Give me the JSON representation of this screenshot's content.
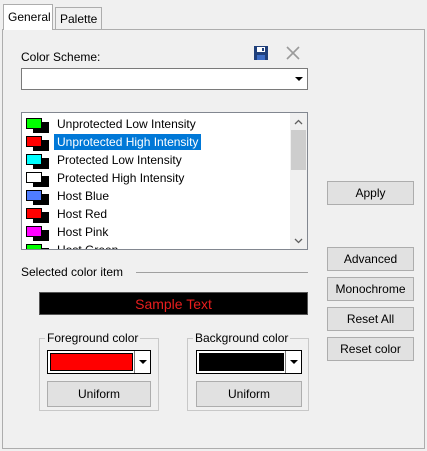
{
  "tabs": [
    {
      "label": "General",
      "active": true
    },
    {
      "label": "Palette",
      "active": false
    }
  ],
  "color_scheme": {
    "label": "Color Scheme:",
    "value": "",
    "save_icon": "save-icon",
    "delete_icon": "close-icon"
  },
  "color_items": [
    {
      "label": "Unprotected Low Intensity",
      "color": "#00ff00",
      "selected": false
    },
    {
      "label": "Unprotected High Intensity",
      "color": "#ff0000",
      "selected": true
    },
    {
      "label": "Protected Low Intensity",
      "color": "#00ffff",
      "selected": false
    },
    {
      "label": "Protected High Intensity",
      "color": "#ffffff",
      "selected": false
    },
    {
      "label": "Host Blue",
      "color": "#4f7cff",
      "selected": false
    },
    {
      "label": "Host Red",
      "color": "#ff0000",
      "selected": false
    },
    {
      "label": "Host Pink",
      "color": "#ff00ff",
      "selected": false
    },
    {
      "label": "Host Green",
      "color": "#00ff00",
      "selected": false
    }
  ],
  "selected_color_item": {
    "label": "Selected color item",
    "sample_text": "Sample Text",
    "sample_fg": "#e81e1e",
    "sample_bg": "#000000"
  },
  "foreground": {
    "title": "Foreground color",
    "color": "#ff0000",
    "uniform_label": "Uniform"
  },
  "background": {
    "title": "Background color",
    "color": "#000000",
    "uniform_label": "Uniform"
  },
  "buttons": {
    "apply": "Apply",
    "advanced": "Advanced",
    "monochrome": "Monochrome",
    "reset_all": "Reset All",
    "reset_color": "Reset color"
  }
}
